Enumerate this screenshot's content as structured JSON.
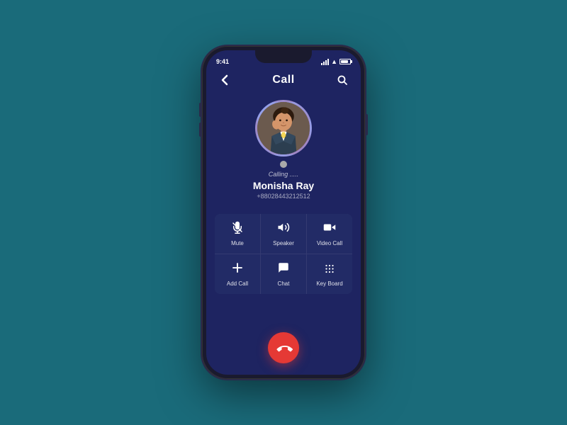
{
  "phone": {
    "status_bar": {
      "time": "9:41",
      "signal": "▌▌▌",
      "wifi": "WiFi",
      "battery": "Battery"
    },
    "header": {
      "title": "Call",
      "back_label": "‹",
      "search_label": "⌕"
    },
    "contact": {
      "calling_text": "Calling .....",
      "name": "Monisha Ray",
      "phone": "+88028443212512"
    },
    "action_buttons": [
      {
        "id": "mute",
        "icon": "🎤",
        "label": "Mute"
      },
      {
        "id": "speaker",
        "icon": "🔊",
        "label": "Speaker"
      },
      {
        "id": "video-call",
        "icon": "📹",
        "label": "Video Call"
      },
      {
        "id": "add-call",
        "icon": "+",
        "label": "Add Call"
      },
      {
        "id": "chat",
        "icon": "💬",
        "label": "Chat"
      },
      {
        "id": "keyboard",
        "icon": "⠿",
        "label": "Key Board"
      }
    ],
    "end_call": {
      "label": "End Call"
    }
  },
  "colors": {
    "background": "#1a6b7a",
    "phone_bg": "#1e2461",
    "end_call_red": "#e53935",
    "header_text": "#ffffff"
  }
}
